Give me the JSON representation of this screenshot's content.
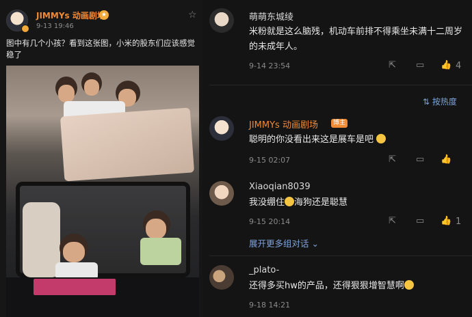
{
  "post": {
    "author": "JIMMYs 动画剧场",
    "time": "9-13 19:46",
    "text": "图中有几个小孩？看到这张图，小米的股东们应该感觉稳了",
    "crown_icon": "crown-badge-icon",
    "star_icon": "star-icon"
  },
  "comments": [
    {
      "name": "萌萌东城绫",
      "text": "米粉就是这么脑残，机动车前排不得乘坐未满十二周岁的未成年人。",
      "time": "9-14 23:54",
      "likes": "4",
      "name_color": "#d9d9d9"
    },
    {
      "name": "JIMMYs 动画剧场",
      "badge": "博主",
      "text": "聪明的你没看出来这是展车是吧",
      "time": "9-15 02:07",
      "likes": "",
      "name_color": "#f08a34"
    },
    {
      "name": "Xiaoqian8039",
      "text_a": "我没绷住",
      "text_b": "海狗还是聪慧",
      "time": "9-15 20:14",
      "likes": "1",
      "name_color": "#d9d9d9"
    },
    {
      "name": "_plato-",
      "text": "还得多买hw的产品，还得狠狠增智慧啊",
      "time": "9-18 14:21",
      "name_color": "#d9d9d9"
    }
  ],
  "sort_label": "按热度",
  "expand_label": "展开更多组对话",
  "colors": {
    "accent": "#f08a34",
    "link": "#7ea2d8",
    "bg": "#141414"
  }
}
